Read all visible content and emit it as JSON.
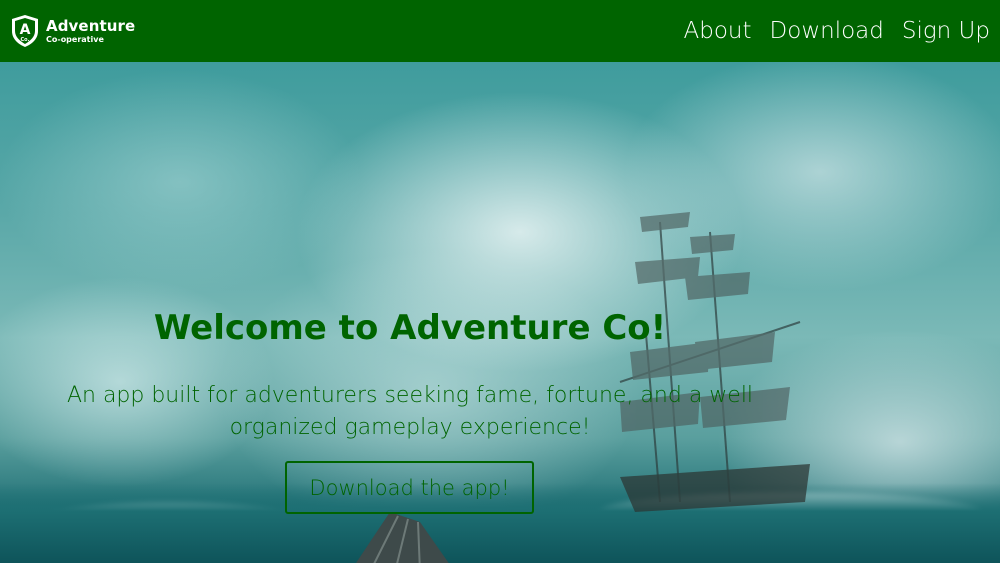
{
  "header": {
    "brand_name": "Adventure",
    "brand_sub": "Co-operative",
    "logo_letter": "A",
    "logo_sub": "Co.",
    "nav": [
      {
        "label": "About"
      },
      {
        "label": "Download"
      },
      {
        "label": "Sign Up"
      }
    ]
  },
  "hero": {
    "title": "Welcome to Adventure Co!",
    "subtitle_line1": "An app built for adventurers seeking fame, fortune, and a well",
    "subtitle_line2": "organized gameplay experience!",
    "cta_label": "Download the app!"
  },
  "colors": {
    "brand_green": "#006400",
    "nav_text": "#ffffff"
  },
  "icons": {
    "logo": "shield-logo-icon"
  }
}
